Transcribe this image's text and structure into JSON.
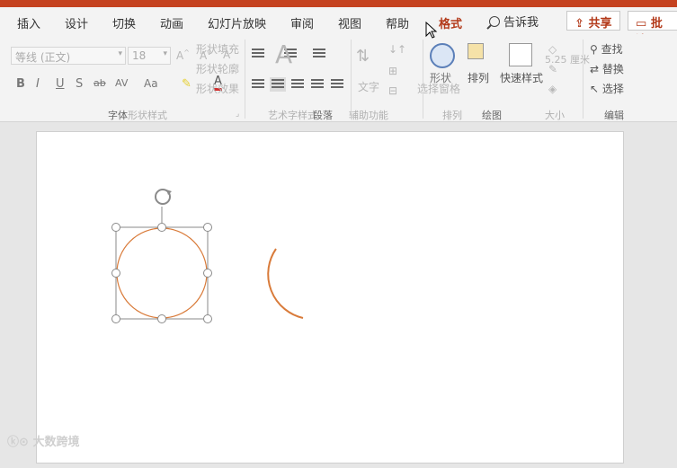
{
  "tabs": [
    {
      "label": "插入"
    },
    {
      "label": "设计"
    },
    {
      "label": "切换"
    },
    {
      "label": "动画"
    },
    {
      "label": "幻灯片放映"
    },
    {
      "label": "审阅"
    },
    {
      "label": "视图"
    },
    {
      "label": "帮助"
    },
    {
      "label": "格式"
    }
  ],
  "active_tab": "格式",
  "tell_me": "告诉我",
  "share_label": "共享",
  "comment_label": "批注",
  "ribbon": {
    "font_name": "等线 (正文)",
    "font_size": "18",
    "shape_fill": "形状填充",
    "shape_outline": "形状轮廓",
    "shape_effect": "形状效果",
    "arrange_label": "排列",
    "quick_styles_label": "快速样式",
    "shape_label": "形状",
    "find_label": "查找",
    "replace_label": "替换",
    "select_label": "选择",
    "selection_pane": "选择窗格",
    "size_value": "5.25 厘米",
    "groups": {
      "font": "字体",
      "shape_styles": "形状样式",
      "wordart": "艺术字样式",
      "paragraph": "段落",
      "accessibility": "辅助功能",
      "arrange": "排列",
      "drawing": "绘图",
      "size": "大小",
      "editing": "编辑"
    }
  },
  "colors": {
    "accent": "#c5421f",
    "shape_stroke": "#d97b3a",
    "handle": "#8a8a8a"
  },
  "watermark": "大数跨境"
}
